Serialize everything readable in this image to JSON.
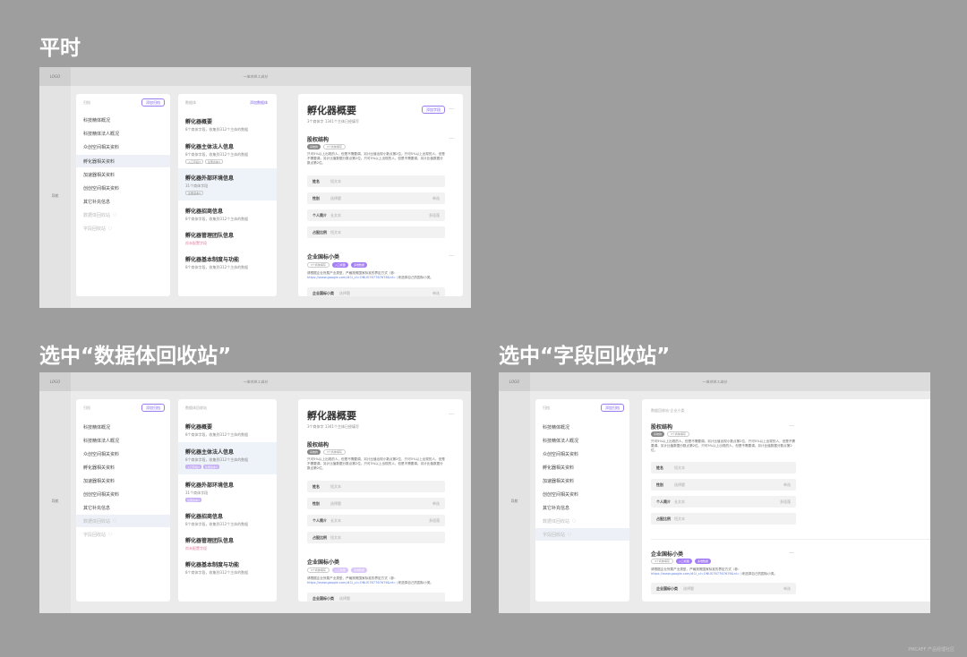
{
  "sections": [
    {
      "title": "平时"
    },
    {
      "title": "选中“数据体回收站”"
    },
    {
      "title": "选中“字段回收站”"
    }
  ],
  "app": {
    "logo": "LOGO",
    "title": "一堆项目工具社",
    "nav_label": "导航"
  },
  "left_panel": {
    "header": "归档",
    "add_button": "添加归档",
    "items": [
      "科技精体概况",
      "科技精体法人概况",
      "众创空间相关资料",
      "孵化器相关资料",
      "加速器相关资料",
      "创创空间相关资料",
      "其它补充信息",
      "数据体回收站",
      "字段回收站"
    ],
    "recycle_icon": "recycle-icon"
  },
  "mid_panel": {
    "header_a": "数据体",
    "header_b": "数据体回收站",
    "add_button": "添加数据体",
    "items": [
      {
        "title": "孵化器概要",
        "sub": "8个商体字段，收集到312个主体的数据"
      },
      {
        "title": "孵化器主体法人信息",
        "sub": "8个商体字段，收集到312个主体的数据",
        "tags": [
          "入口字段3",
          "注册资本3"
        ]
      },
      {
        "title": "孵化器外部环境信息",
        "sub": "31个商体字段",
        "tags": [
          "注册资本3"
        ]
      },
      {
        "title": "孵化器招商信息",
        "sub": "8个商体字段，收集到312个主体的数据"
      },
      {
        "title": "孵化器管理团队信息",
        "sub": "尚未配置字段"
      },
      {
        "title": "孵化器基本制度与功能",
        "sub": "8个商体字段，收集到312个主体的数据"
      }
    ]
  },
  "detail": {
    "title": "孵化器概要",
    "sub": "3个商体字 1341个主体已经填写",
    "share_button": "添加字段",
    "more": "···",
    "equity": {
      "title": "股权结构",
      "tags": [
        "系统的",
        "3个商体填写"
      ],
      "text": "只可5%以上出现的人，但是不需要调。另计比值出现小数点第2位，只可5%以上出现的人，但是不需要调。另计比值数据分数点第2位。只可5%以上出现的人，但是不需要调。另计比值数据分数点第2位。"
    },
    "fields": [
      {
        "label": "姓名",
        "value": "短文本",
        "hint": ""
      },
      {
        "label": "性别",
        "value": "选择题",
        "hint": "单选"
      },
      {
        "label": "个人简介",
        "value": "长文本",
        "hint": "多段落"
      },
      {
        "label": "占股比例",
        "value": "短文本",
        "hint": ""
      }
    ],
    "industry": {
      "title": "企业国标小类",
      "tags": [
        "3个商体填写",
        "入口视图",
        "多维数据"
      ],
      "text": "请根据企业所属产业类型，严格按照国家标准的界定方式（参：",
      "link": "https://www.google.com/#1l_cl=ONUS767767676&nI= )",
      "text2": "来选择自己的国标小类。",
      "field": {
        "label": "企业国标小类",
        "value": "选择题",
        "hint": "单选"
      }
    }
  },
  "third_detail_header": "数据回收站-企业小类",
  "footer": "PMCAFF 产品经理社区",
  "colors": {
    "accent": "#7b5cf0",
    "selected_row": "#edf1f7",
    "bg": "#9e9e9e"
  }
}
